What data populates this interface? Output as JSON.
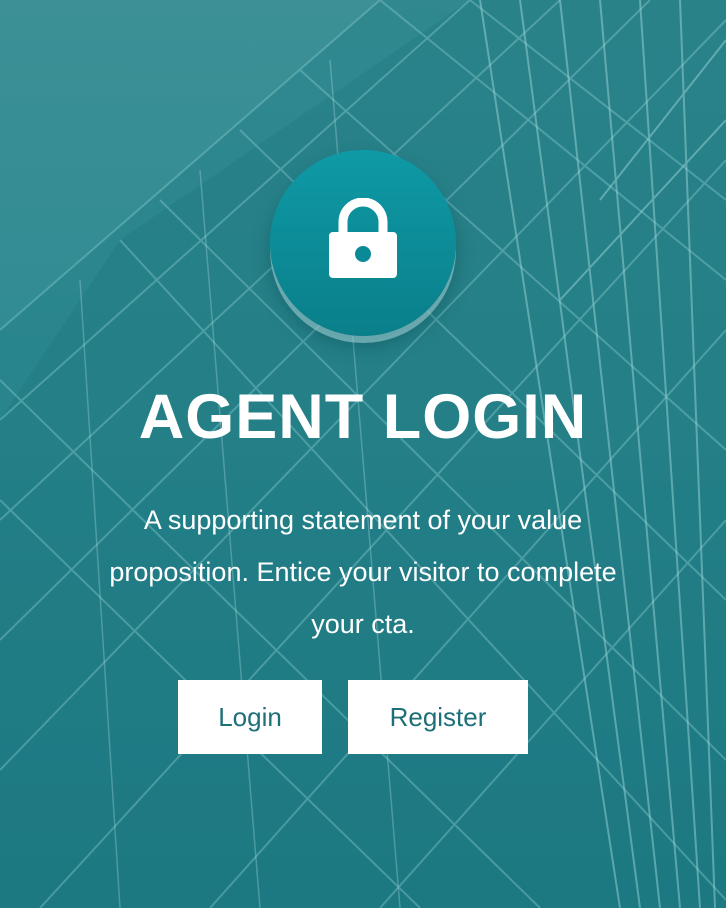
{
  "hero": {
    "title": "AGENT LOGIN",
    "subtitle": "A supporting statement of your value proposition. Entice your visitor to complete your cta.",
    "icon": "lock-icon"
  },
  "buttons": {
    "login_label": "Login",
    "register_label": "Register"
  },
  "colors": {
    "background_teal": "#2f8a92",
    "badge_teal": "#0a8a96",
    "button_text": "#1d6f78",
    "white": "#ffffff"
  }
}
